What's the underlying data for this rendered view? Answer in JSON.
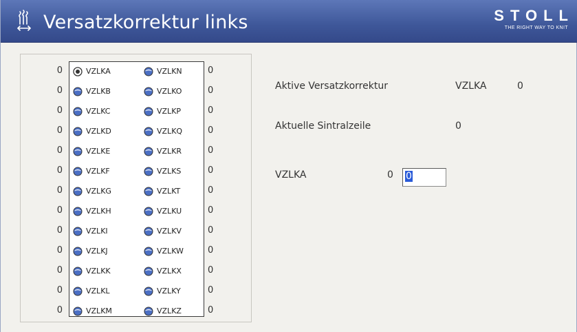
{
  "window": {
    "title": "Versatzkorrektur links",
    "brand": "STOLL",
    "brand_tagline": "THE RIGHT WAY TO KNIT",
    "header_icon": "needle-offset-icon"
  },
  "selector": {
    "selected": "VZLKA",
    "left_values": [
      "0",
      "0",
      "0",
      "0",
      "0",
      "0",
      "0",
      "0",
      "0",
      "0",
      "0",
      "0",
      "0"
    ],
    "right_values": [
      "0",
      "0",
      "0",
      "0",
      "0",
      "0",
      "0",
      "0",
      "0",
      "0",
      "0",
      "0",
      "0"
    ],
    "column1": [
      "VZLKA",
      "VZLKB",
      "VZLKC",
      "VZLKD",
      "VZLKE",
      "VZLKF",
      "VZLKG",
      "VZLKH",
      "VZLKI",
      "VZLKJ",
      "VZLKK",
      "VZLKL",
      "VZLKM"
    ],
    "column2": [
      "VZLKN",
      "VZLKO",
      "VZLKP",
      "VZLKQ",
      "VZLKR",
      "VZLKS",
      "VZLKT",
      "VZLKU",
      "VZLKV",
      "VZLKW",
      "VZLKX",
      "VZLKY",
      "VZLKZ"
    ]
  },
  "info": {
    "active_label": "Aktive Versatzkorrektur",
    "active_name": "VZLKA",
    "active_value": "0",
    "sintral_label": "Aktuelle Sintralzeile",
    "sintral_value": "0",
    "edit_label": "VZLKA",
    "edit_current": "0",
    "edit_input_value": "0"
  },
  "colors": {
    "header_bg": "#3e5799",
    "radio_fill": "#4b6fc4",
    "selection": "#2a5bd8"
  }
}
